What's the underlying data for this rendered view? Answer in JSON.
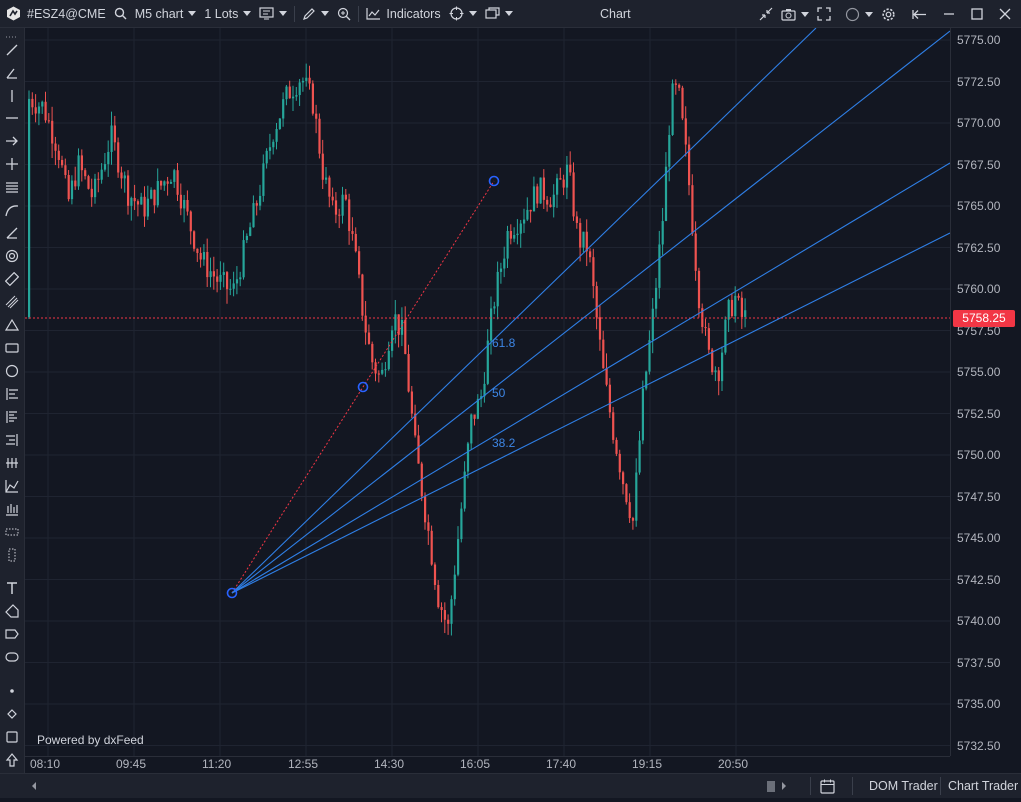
{
  "toolbar": {
    "symbol": "#ESZ4@CME",
    "timeframe": "M5 chart",
    "lots": "1 Lots",
    "indicators_label": "Indicators",
    "window_title": "Chart"
  },
  "chart": {
    "price_ticks": [
      "5775.00",
      "5772.50",
      "5770.00",
      "5767.50",
      "5765.00",
      "5762.50",
      "5760.00",
      "5757.50",
      "5755.00",
      "5752.50",
      "5750.00",
      "5747.50",
      "5745.00",
      "5742.50",
      "5740.00",
      "5737.50",
      "5735.00",
      "5732.50"
    ],
    "time_ticks": [
      "08:10",
      "09:45",
      "11:20",
      "12:55",
      "14:30",
      "16:05",
      "17:40",
      "19:15",
      "20:50"
    ],
    "current_price": "5758.25",
    "fib_labels": [
      "61.8",
      "50",
      "38.2"
    ],
    "powered_by": "Powered by dxFeed",
    "colors": {
      "up": "#26a69a",
      "down": "#ef5350",
      "fan": "#2f7fe6",
      "background": "#131722"
    }
  },
  "bottom": {
    "dom_trader": "DOM Trader",
    "chart_trader": "Chart Trader"
  }
}
